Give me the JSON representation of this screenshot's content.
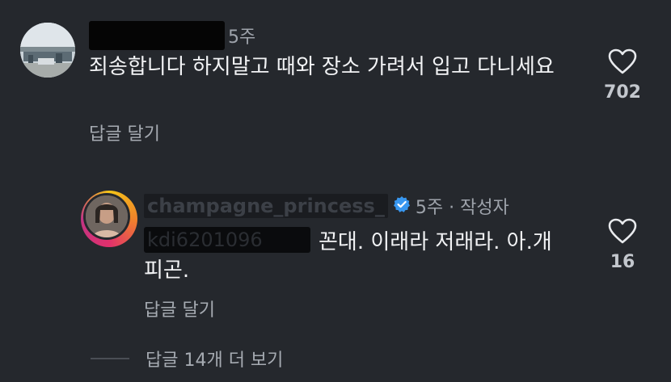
{
  "comments": [
    {
      "time": "5주",
      "text": "죄송합니다 하지말고 때와 장소 가려서 입고 다니세요",
      "reply_label": "답글 달기",
      "likes": "702"
    }
  ],
  "reply": {
    "username": "champagne_princess_",
    "time": "5주",
    "author_badge": "작성자",
    "mention": "kdi6201096",
    "text_line1": "꼰대. 이래라 저래라. 아.개",
    "text_line2": "피곤.",
    "reply_label": "답글 달기",
    "likes": "16"
  },
  "more_replies": {
    "label": "답글 14개 더 보기"
  },
  "colors": {
    "background": "#25282d",
    "verified": "#3897f0",
    "text": "#f2f3f5",
    "muted": "#a6abb2"
  },
  "icons": {
    "like": "heart-icon",
    "verified": "verified-badge-icon"
  }
}
